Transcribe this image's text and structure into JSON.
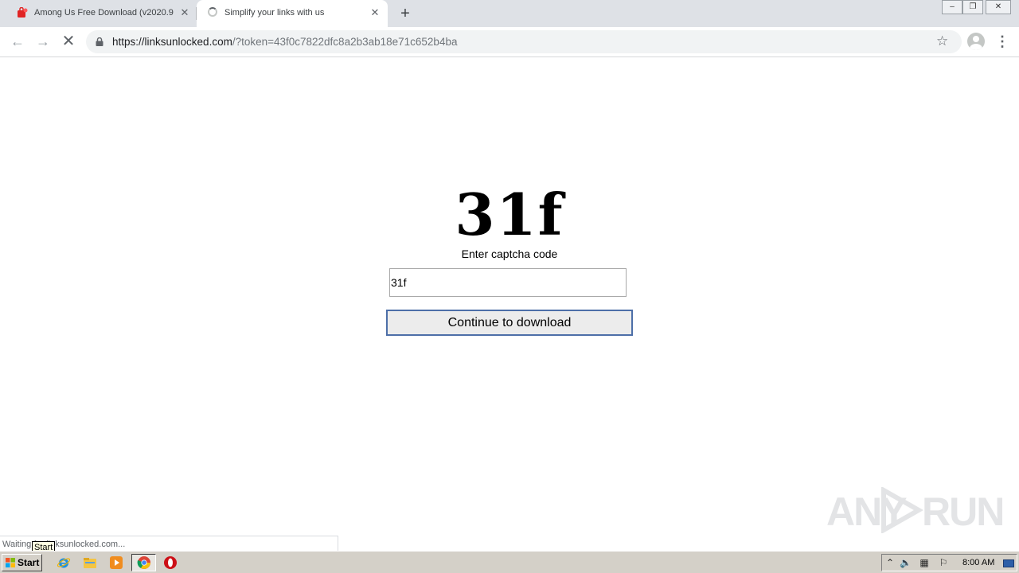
{
  "browser": {
    "tabs": [
      {
        "title": "Among Us Free Download (v2020.9.",
        "favicon": "red-bag-icon",
        "active": false
      },
      {
        "title": "Simplify your links with us",
        "favicon": "loading-spinner-icon",
        "active": true
      }
    ],
    "new_tab": "+",
    "window_controls": {
      "minimize": "–",
      "maximize": "❐",
      "close": "✕"
    },
    "url": {
      "host": "https://linksunlocked.com",
      "path": "/?token=43f0c7822dfc8a2b3ab18e71c652b4ba"
    },
    "status": "Waiting for linksunlocked.com..."
  },
  "page": {
    "captcha_code": "31f",
    "captcha_label": "Enter captcha code",
    "input_value": "31f",
    "button_label": "Continue to download"
  },
  "watermark": {
    "left": "ANY",
    "right": "RUN"
  },
  "taskbar": {
    "start_label": "Start",
    "start_tooltip": "Start",
    "clock": "8:00 AM",
    "pinned": [
      "internet-explorer-icon",
      "file-explorer-icon",
      "media-player-icon",
      "chrome-icon",
      "opera-icon"
    ]
  },
  "colors": {
    "tabstrip": "#dee1e6",
    "omnibox": "#f1f3f4",
    "button_border": "#4d6fa8",
    "taskbar": "#d4d0c8"
  }
}
